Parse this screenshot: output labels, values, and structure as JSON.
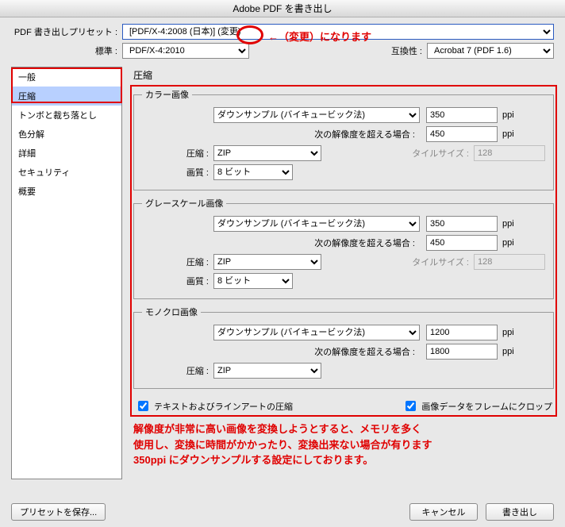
{
  "title": "Adobe PDF を書き出し",
  "preset": {
    "label": "PDF 書き出しプリセット :",
    "value": "[PDF/X-4:2008 (日本)] (変更)"
  },
  "annotation_preset": "←（変更）になります",
  "standard": {
    "label": "標準 :",
    "value": "PDF/X-4:2010"
  },
  "compat": {
    "label": "互換性 :",
    "value": "Acrobat 7 (PDF 1.6)"
  },
  "sidebar": {
    "items": [
      "一般",
      "圧縮",
      "トンボと裁ち落とし",
      "色分解",
      "詳細",
      "セキュリティ",
      "概要"
    ],
    "selected": 1
  },
  "section_title": "圧縮",
  "groups": {
    "color": {
      "legend": "カラー画像",
      "downsample": "ダウンサンプル (バイキュービック法)",
      "ppi": "350",
      "threshold_label": "次の解像度を超える場合 :",
      "threshold": "450",
      "ppi_unit": "ppi",
      "compress_label": "圧縮 :",
      "compress": "ZIP",
      "tile_label": "タイルサイズ :",
      "tile": "128",
      "quality_label": "画質 :",
      "quality": "8 ビット"
    },
    "gray": {
      "legend": "グレースケール画像",
      "downsample": "ダウンサンプル (バイキュービック法)",
      "ppi": "350",
      "threshold_label": "次の解像度を超える場合 :",
      "threshold": "450",
      "ppi_unit": "ppi",
      "compress_label": "圧縮 :",
      "compress": "ZIP",
      "tile_label": "タイルサイズ :",
      "tile": "128",
      "quality_label": "画質 :",
      "quality": "8 ビット"
    },
    "mono": {
      "legend": "モノクロ画像",
      "downsample": "ダウンサンプル (バイキュービック法)",
      "ppi": "1200",
      "threshold_label": "次の解像度を超える場合 :",
      "threshold": "1800",
      "ppi_unit": "ppi",
      "compress_label": "圧縮 :",
      "compress": "ZIP"
    }
  },
  "checkboxes": {
    "text_lineart": "テキストおよびラインアートの圧縮",
    "crop_frame": "画像データをフレームにクロップ"
  },
  "bottom_note": {
    "line1": "解像度が非常に高い画像を変換しようとすると、メモリを多く",
    "line2": "使用し、変換に時間がかかったり、変換出来ない場合が有ります",
    "line3": "350ppi にダウンサンプルする設定にしております。"
  },
  "buttons": {
    "save_preset": "プリセットを保存...",
    "cancel": "キャンセル",
    "export": "書き出し"
  }
}
